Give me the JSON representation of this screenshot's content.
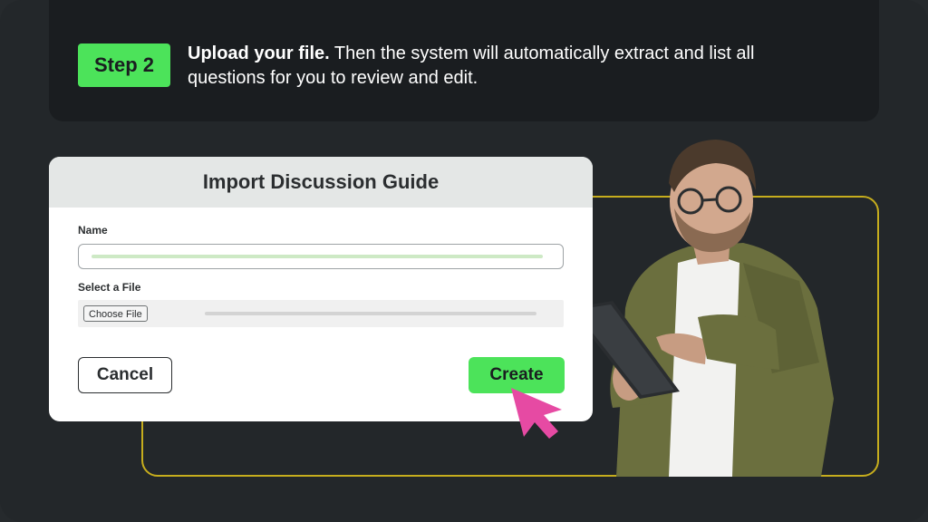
{
  "step": {
    "badge": "Step 2",
    "lead": "Upload your file.",
    "description": " Then the system will automatically extract and list all questions for you to review and edit."
  },
  "dialog": {
    "title": "Import Discussion Guide",
    "name_label": "Name",
    "file_label": "Select a File",
    "choose_file_label": "Choose File",
    "cancel_label": "Cancel",
    "create_label": "Create"
  },
  "colors": {
    "accent_green": "#4ce35a",
    "accent_yellow": "#c6ad1d",
    "cursor_pink": "#e64aa3",
    "background": "#23272a"
  },
  "icons": {
    "cursor": "mouse-pointer-icon"
  }
}
